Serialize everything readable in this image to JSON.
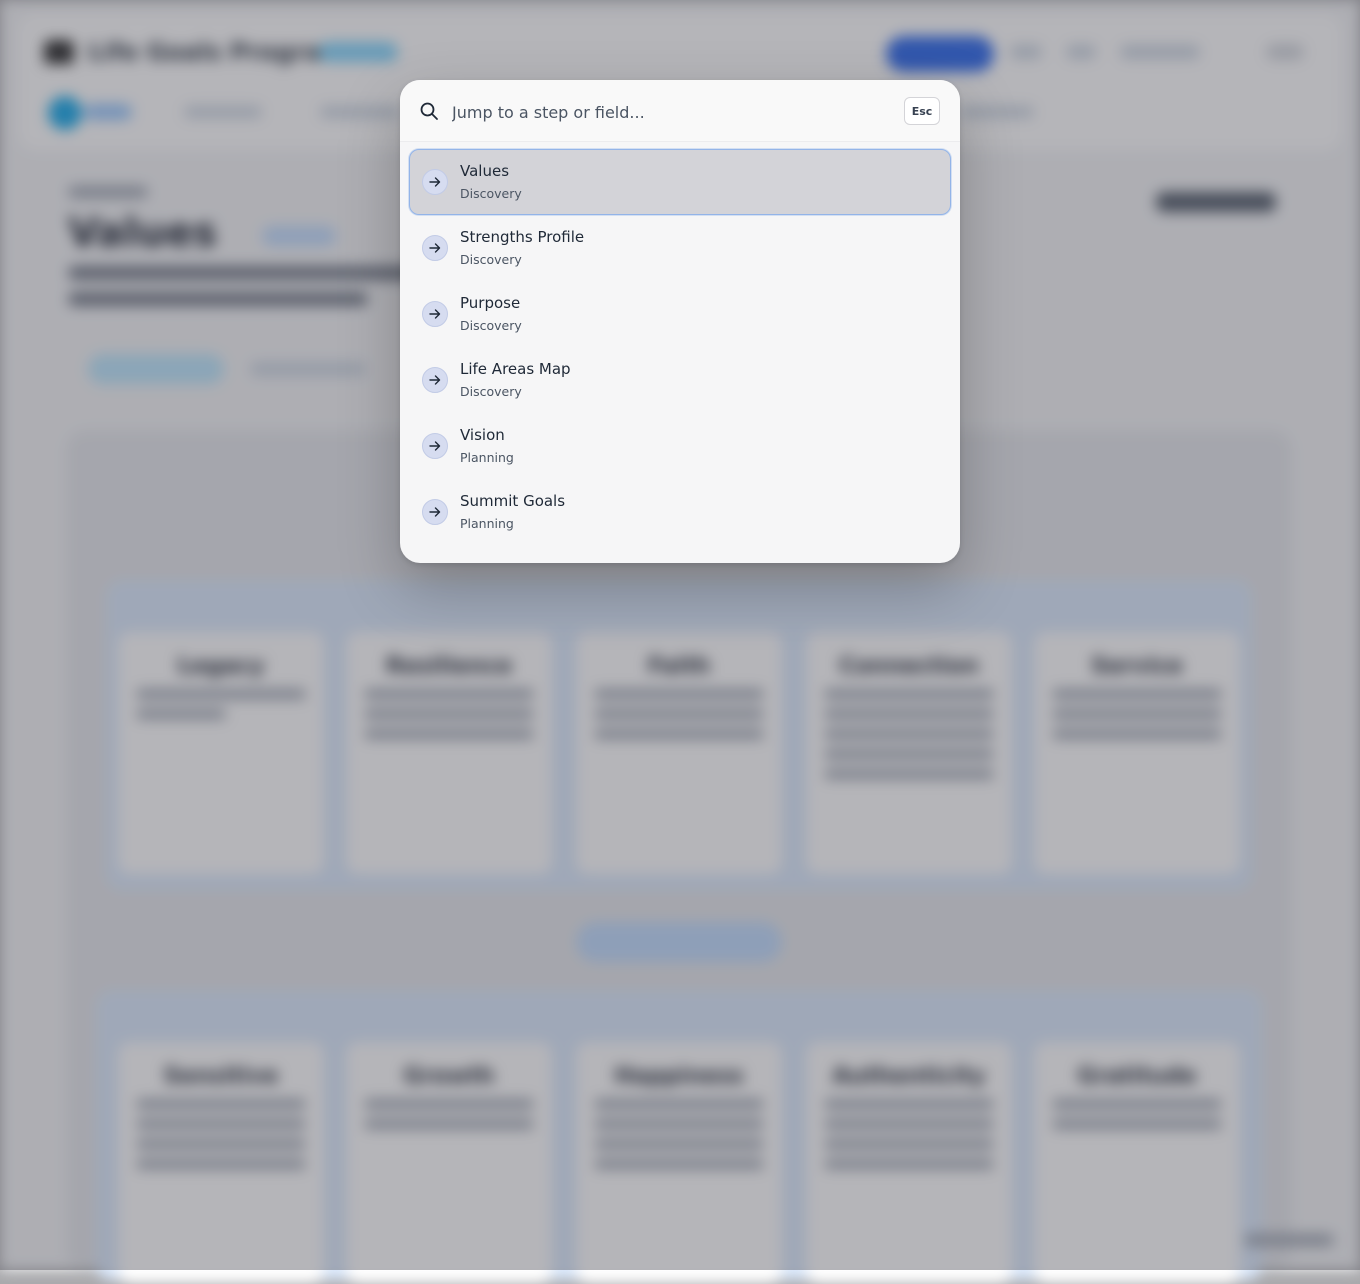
{
  "background_app": {
    "app_title": "Life Goals Program",
    "page_title": "Values",
    "card_titles_row1": [
      "Legacy",
      "Resilience",
      "Faith",
      "Connection",
      "Service"
    ],
    "card_titles_row2": [
      "Sensitive",
      "Growth",
      "Happiness",
      "Authenticity",
      "Gratitude"
    ]
  },
  "palette": {
    "search": {
      "placeholder": "Jump to a step or field...",
      "value": "",
      "icon": "search-icon"
    },
    "esc_label": "Esc",
    "results": [
      {
        "title": "Values",
        "section": "Discovery",
        "selected": true,
        "icon": "arrow-right-icon"
      },
      {
        "title": "Strengths Profile",
        "section": "Discovery",
        "selected": false,
        "icon": "arrow-right-icon"
      },
      {
        "title": "Purpose",
        "section": "Discovery",
        "selected": false,
        "icon": "arrow-right-icon"
      },
      {
        "title": "Life Areas Map",
        "section": "Discovery",
        "selected": false,
        "icon": "arrow-right-icon"
      },
      {
        "title": "Vision",
        "section": "Planning",
        "selected": false,
        "icon": "arrow-right-icon"
      },
      {
        "title": "Summit Goals",
        "section": "Planning",
        "selected": false,
        "icon": "arrow-right-icon"
      }
    ]
  },
  "colors": {
    "accent_border": "#93b4e8",
    "selected_bg": "#d3d3d8",
    "icon_circle": "#d6dcf0",
    "overlay": "#46464f"
  }
}
